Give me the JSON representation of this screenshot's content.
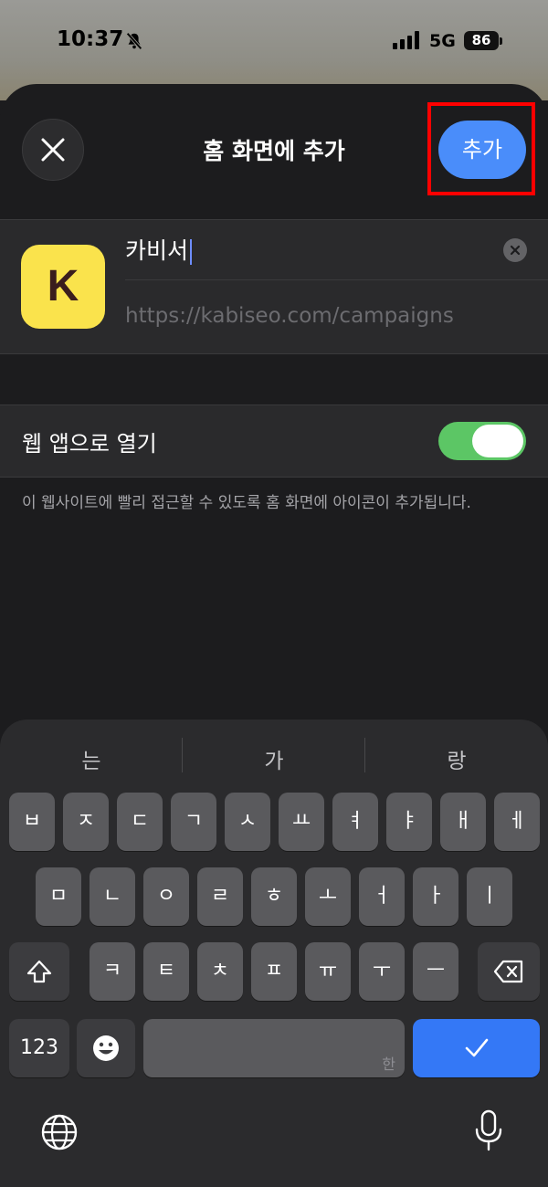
{
  "status_bar": {
    "time": "10:37",
    "network": "5G",
    "battery": "86",
    "icons": [
      "bell-off-icon",
      "signal-icon"
    ]
  },
  "sheet": {
    "title": "홈 화면에 추가",
    "add_label": "추가",
    "close_icon": "close-icon"
  },
  "app_card": {
    "icon_letter": "K",
    "icon_color": "#fae34c",
    "name_value": "카비서",
    "url": "https://kabiseo.com/campaigns"
  },
  "web_app_row": {
    "label": "웹 앱으로 열기",
    "enabled": true,
    "toggle_color": "#5cc665"
  },
  "footnote": "이 웹사이트에 빨리 접근할 수 있도록 홈 화면에 아이콘이 추가됩니다.",
  "keyboard": {
    "suggestions": [
      "는",
      "가",
      "랑"
    ],
    "row1": [
      "ㅂ",
      "ㅈ",
      "ㄷ",
      "ㄱ",
      "ㅅ",
      "ㅛ",
      "ㅕ",
      "ㅑ",
      "ㅐ",
      "ㅔ"
    ],
    "row2": [
      "ㅁ",
      "ㄴ",
      "ㅇ",
      "ㄹ",
      "ㅎ",
      "ㅗ",
      "ㅓ",
      "ㅏ",
      "ㅣ"
    ],
    "row3": [
      "ㅋ",
      "ㅌ",
      "ㅊ",
      "ㅍ",
      "ㅠ",
      "ㅜ",
      "ㅡ"
    ],
    "numbers_label": "123",
    "space_hint": "한",
    "return_icon": "checkmark-icon",
    "bottom_icons": [
      "globe-icon",
      "microphone-icon"
    ],
    "return_color": "#3478f6"
  }
}
